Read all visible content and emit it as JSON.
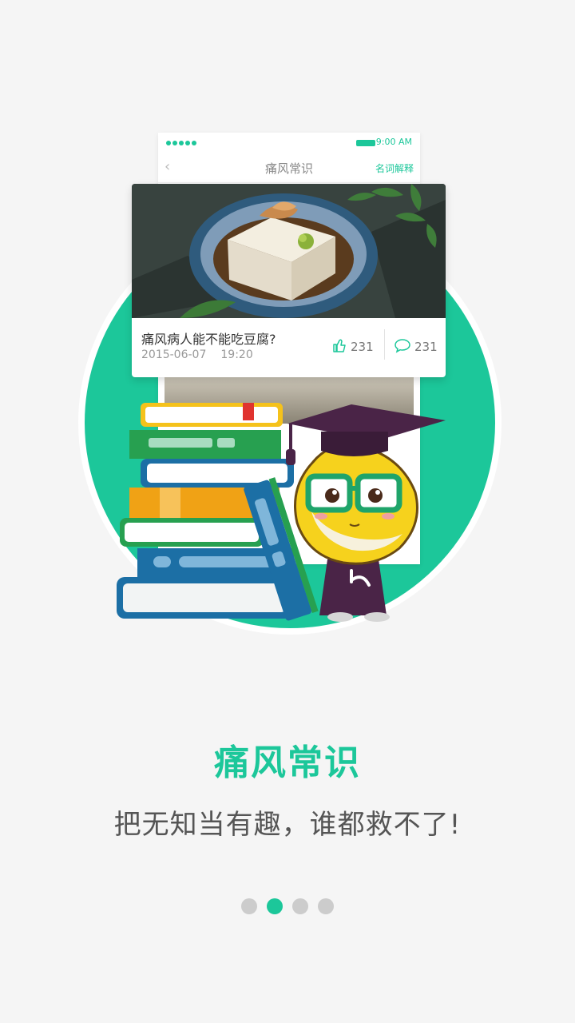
{
  "phone": {
    "time": "9:00 AM",
    "nav_title": "痛风常识",
    "nav_right": "名词解释"
  },
  "article": {
    "title": "痛风病人能不能吃豆腐?",
    "date": "2015-06-07",
    "time": "19:20",
    "likes": "231",
    "comments": "231"
  },
  "headline": "痛风常识",
  "subtitle": "把无知当有趣，谁都救不了!",
  "pager": {
    "total": 4,
    "active_index": 1
  },
  "colors": {
    "accent": "#1cc79a",
    "background": "#f5f5f5",
    "inactive_dot": "#cccccc"
  }
}
